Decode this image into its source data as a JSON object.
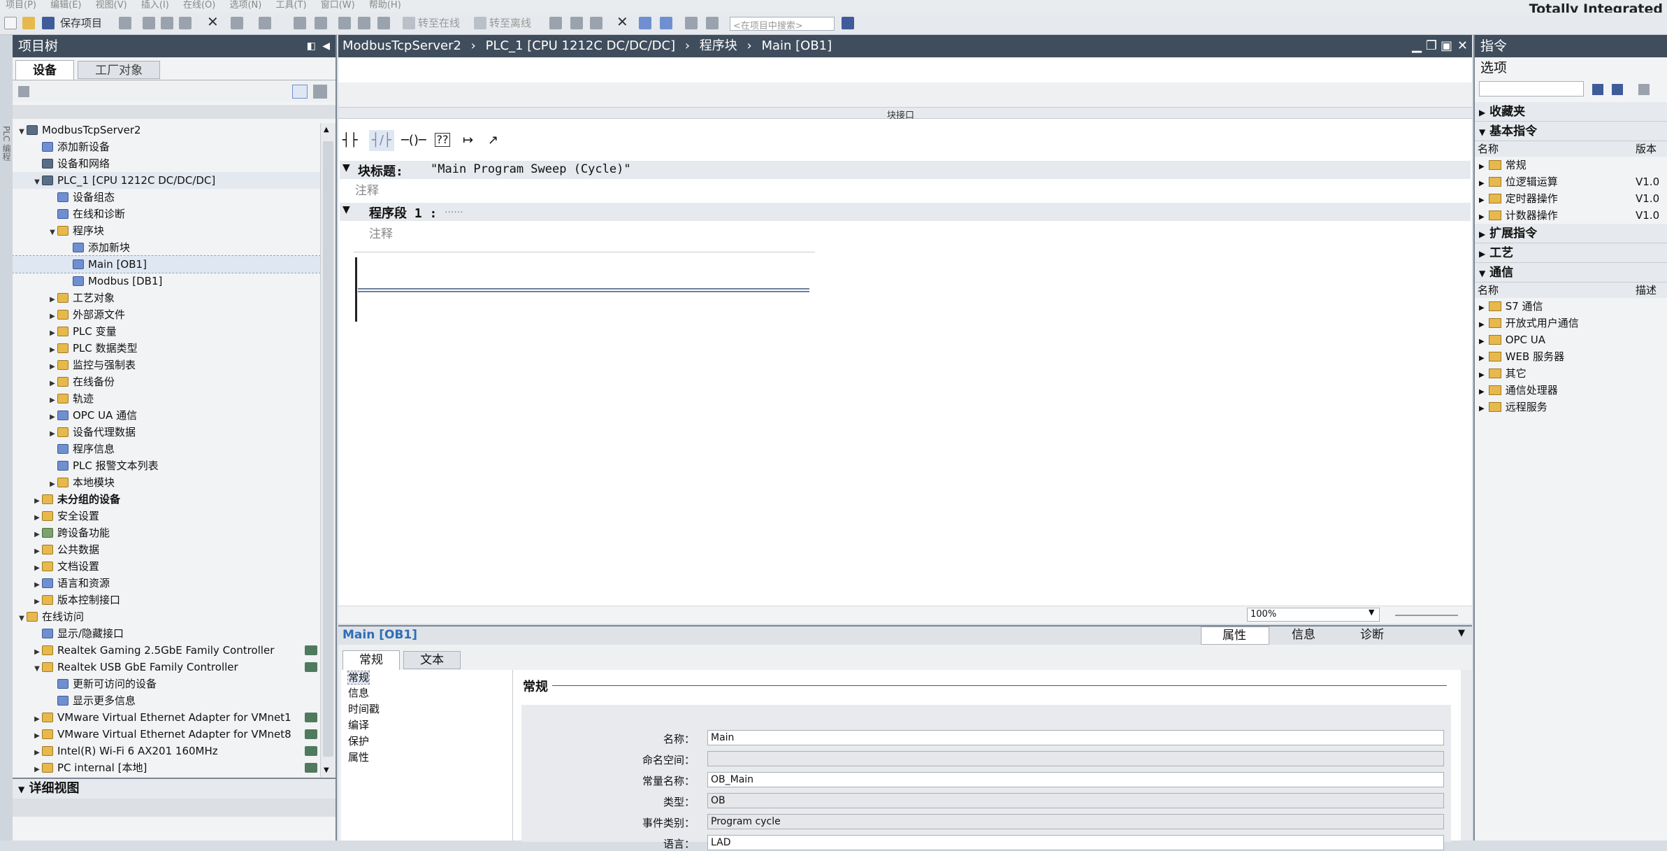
{
  "menu": [
    "项目(P)",
    "编辑(E)",
    "视图(V)",
    "插入(I)",
    "在线(O)",
    "选项(N)",
    "工具(T)",
    "窗口(W)",
    "帮助(H)"
  ],
  "brand": "Totally Integrated",
  "toolbar": {
    "save": "保存项目",
    "go_online": "转至在线",
    "go_offline": "转至离线",
    "search_placeholder": "<在项目中搜索>"
  },
  "left": {
    "title": "项目树",
    "tabs": [
      "设备",
      "工厂对象"
    ],
    "detail": "详细视图",
    "vertical": "PLC 编程",
    "tree": [
      {
        "t": "ModbusTcpServer2",
        "lvl": 0,
        "tw": "▼",
        "ic": "d"
      },
      {
        "t": "添加新设备",
        "lvl": 1,
        "tw": "",
        "ic": "b"
      },
      {
        "t": "设备和网络",
        "lvl": 1,
        "tw": "",
        "ic": "d"
      },
      {
        "t": "PLC_1 [CPU 1212C DC/DC/DC]",
        "lvl": 1,
        "tw": "▼",
        "ic": "d",
        "hl": true
      },
      {
        "t": "设备组态",
        "lvl": 2,
        "tw": "",
        "ic": "b"
      },
      {
        "t": "在线和诊断",
        "lvl": 2,
        "tw": "",
        "ic": "b"
      },
      {
        "t": "程序块",
        "lvl": 2,
        "tw": "▼",
        "ic": "f"
      },
      {
        "t": "添加新块",
        "lvl": 3,
        "tw": "",
        "ic": "b"
      },
      {
        "t": "Main [OB1]",
        "lvl": 3,
        "tw": "",
        "ic": "b",
        "sel": true
      },
      {
        "t": "Modbus [DB1]",
        "lvl": 3,
        "tw": "",
        "ic": "b"
      },
      {
        "t": "工艺对象",
        "lvl": 2,
        "tw": "▶",
        "ic": "f"
      },
      {
        "t": "外部源文件",
        "lvl": 2,
        "tw": "▶",
        "ic": "f"
      },
      {
        "t": "PLC 变量",
        "lvl": 2,
        "tw": "▶",
        "ic": "f"
      },
      {
        "t": "PLC 数据类型",
        "lvl": 2,
        "tw": "▶",
        "ic": "f"
      },
      {
        "t": "监控与强制表",
        "lvl": 2,
        "tw": "▶",
        "ic": "f"
      },
      {
        "t": "在线备份",
        "lvl": 2,
        "tw": "▶",
        "ic": "f"
      },
      {
        "t": "轨迹",
        "lvl": 2,
        "tw": "▶",
        "ic": "f"
      },
      {
        "t": "OPC UA 通信",
        "lvl": 2,
        "tw": "▶",
        "ic": "b"
      },
      {
        "t": "设备代理数据",
        "lvl": 2,
        "tw": "▶",
        "ic": "f"
      },
      {
        "t": "程序信息",
        "lvl": 2,
        "tw": "",
        "ic": "b"
      },
      {
        "t": "PLC 报警文本列表",
        "lvl": 2,
        "tw": "",
        "ic": "b"
      },
      {
        "t": "本地模块",
        "lvl": 2,
        "tw": "▶",
        "ic": "f"
      },
      {
        "t": "未分组的设备",
        "lvl": 1,
        "tw": "▶",
        "ic": "f",
        "bold": true
      },
      {
        "t": "安全设置",
        "lvl": 1,
        "tw": "▶",
        "ic": "f"
      },
      {
        "t": "跨设备功能",
        "lvl": 1,
        "tw": "▶",
        "ic": "g"
      },
      {
        "t": "公共数据",
        "lvl": 1,
        "tw": "▶",
        "ic": "f"
      },
      {
        "t": "文档设置",
        "lvl": 1,
        "tw": "▶",
        "ic": "f"
      },
      {
        "t": "语言和资源",
        "lvl": 1,
        "tw": "▶",
        "ic": "b"
      },
      {
        "t": "版本控制接口",
        "lvl": 1,
        "tw": "▶",
        "ic": "f"
      },
      {
        "t": "在线访问",
        "lvl": 0,
        "tw": "▼",
        "ic": "f"
      },
      {
        "t": "显示/隐藏接口",
        "lvl": 1,
        "tw": "",
        "ic": "b"
      },
      {
        "t": "Realtek Gaming 2.5GbE Family Controller",
        "lvl": 1,
        "tw": "▶",
        "ic": "f",
        "net": true
      },
      {
        "t": "Realtek USB GbE Family Controller",
        "lvl": 1,
        "tw": "▼",
        "ic": "f",
        "net": true
      },
      {
        "t": "更新可访问的设备",
        "lvl": 2,
        "tw": "",
        "ic": "b"
      },
      {
        "t": "显示更多信息",
        "lvl": 2,
        "tw": "",
        "ic": "b"
      },
      {
        "t": "VMware Virtual Ethernet Adapter for VMnet1",
        "lvl": 1,
        "tw": "▶",
        "ic": "f",
        "net": true
      },
      {
        "t": "VMware Virtual Ethernet Adapter for VMnet8",
        "lvl": 1,
        "tw": "▶",
        "ic": "f",
        "net": true
      },
      {
        "t": "Intel(R) Wi-Fi 6 AX201 160MHz",
        "lvl": 1,
        "tw": "▶",
        "ic": "f",
        "net": true
      },
      {
        "t": "PC internal [本地]",
        "lvl": 1,
        "tw": "▶",
        "ic": "f",
        "net": true
      }
    ]
  },
  "editor": {
    "breadcrumb": [
      "ModbusTcpServer2",
      "PLC_1 [CPU 1212C DC/DC/DC]",
      "程序块",
      "Main [OB1]"
    ],
    "interface": "块接口",
    "block_title_label": "块标题:",
    "block_title": "\"Main Program Sweep (Cycle)\"",
    "comment": "注释",
    "network_label": "程序段 1 :",
    "network_dots": "......",
    "network_comment": "注释",
    "zoom": "100%"
  },
  "bottom": {
    "title": "Main [OB1]",
    "tabs": [
      "常规",
      "文本"
    ],
    "right_tabs": [
      "属性",
      "信息",
      "诊断"
    ],
    "nav": [
      "常规",
      "信息",
      "时间戳",
      "编译",
      "保护",
      "属性"
    ],
    "section": "常规",
    "fields": [
      {
        "label": "名称：",
        "value": "Main",
        "ro": false
      },
      {
        "label": "命名空间：",
        "value": "",
        "ro": true
      },
      {
        "label": "常量名称：",
        "value": "OB_Main",
        "ro": false
      },
      {
        "label": "类型：",
        "value": "OB",
        "ro": true
      },
      {
        "label": "事件类别：",
        "value": "Program cycle",
        "ro": true
      },
      {
        "label": "语言：",
        "value": "LAD",
        "ro": false
      }
    ]
  },
  "right": {
    "title": "指令",
    "options": "选项",
    "favorites": "收藏夹",
    "basic": "基本指令",
    "col_name": "名称",
    "col_version": "版本",
    "basic_items": [
      {
        "t": "常规",
        "v": ""
      },
      {
        "t": "位逻辑运算",
        "v": "V1.0"
      },
      {
        "t": "定时器操作",
        "v": "V1.0"
      },
      {
        "t": "计数器操作",
        "v": "V1.0"
      }
    ],
    "extended": "扩展指令",
    "tech": "工艺",
    "comm": "通信",
    "col_desc": "描述",
    "comm_items": [
      "S7 通信",
      "开放式用户通信",
      "OPC UA",
      "WEB 服务器",
      "其它",
      "通信处理器",
      "远程服务"
    ]
  },
  "colors": {
    "header": "#3f4d5c",
    "accent": "#2f6db5",
    "folder": "#e7b94c"
  }
}
